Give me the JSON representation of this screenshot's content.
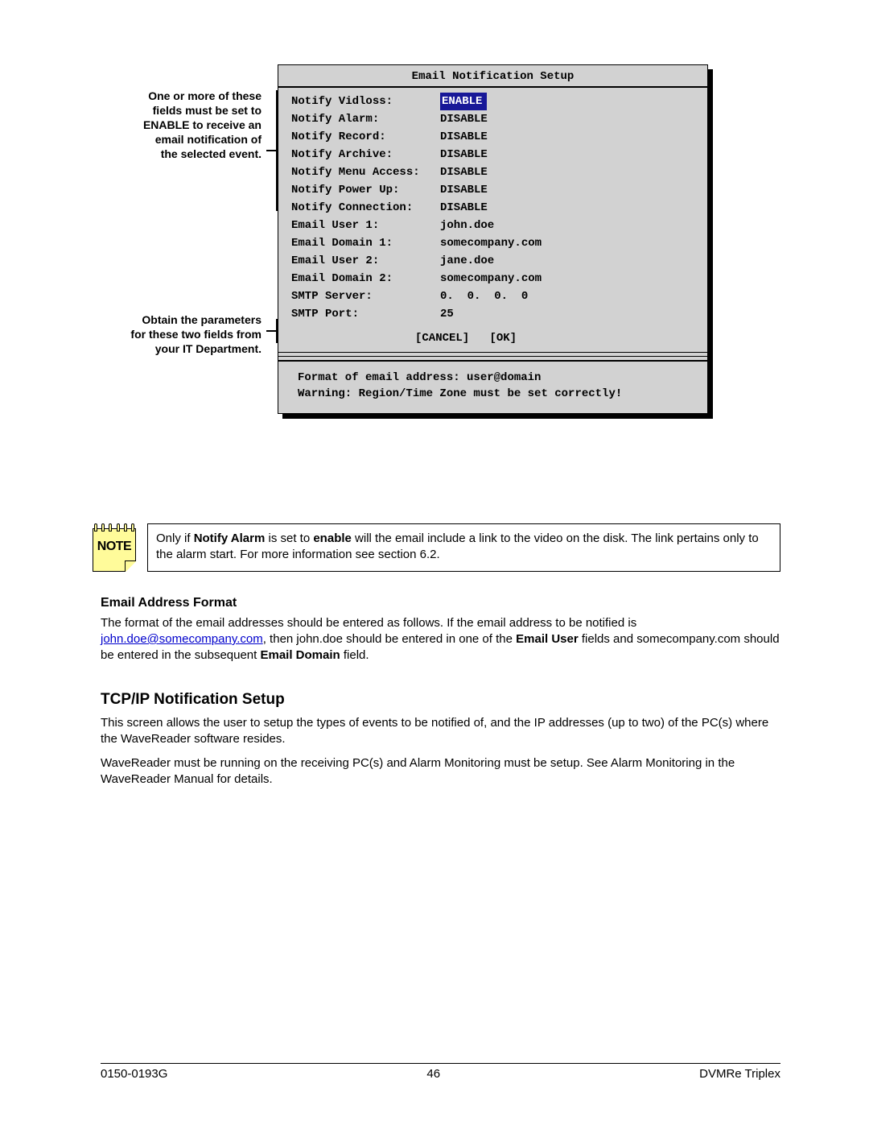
{
  "menu": {
    "title": "Email Notification Setup",
    "rows": [
      {
        "label": "Notify Vidloss:",
        "value": "ENABLE",
        "highlight": true
      },
      {
        "label": "Notify Alarm:",
        "value": "DISABLE"
      },
      {
        "label": "Notify Record:",
        "value": "DISABLE"
      },
      {
        "label": "Notify Archive:",
        "value": "DISABLE"
      },
      {
        "label": "Notify Menu Access:",
        "value": "DISABLE"
      },
      {
        "label": "Notify Power Up:",
        "value": "DISABLE"
      },
      {
        "label": "Notify Connection:",
        "value": "DISABLE"
      },
      {
        "label": "Email User 1:",
        "value": "john.doe"
      },
      {
        "label": "Email Domain 1:",
        "value": "somecompany.com"
      },
      {
        "label": "Email User 2:",
        "value": "jane.doe"
      },
      {
        "label": "Email Domain 2:",
        "value": "somecompany.com"
      },
      {
        "label": "SMTP Server:",
        "value": "0.  0.  0.  0"
      },
      {
        "label": "SMTP Port:",
        "value": "25"
      }
    ],
    "buttons": {
      "cancel": "[CANCEL]",
      "ok": "[OK]"
    },
    "footer1": "Format of email address: user@domain",
    "footer2": "Warning: Region/Time Zone must be set correctly!"
  },
  "callouts": {
    "c1_l1": "One or more of these",
    "c1_l2": "fields must be set to",
    "c1_l3": "ENABLE to receive an",
    "c1_l4": "email notification of",
    "c1_l5": "the selected event.",
    "c2_l1": "Obtain the parameters",
    "c2_l2": "for these two fields from",
    "c2_l3": "your IT Department."
  },
  "note": {
    "badge": "NOTE",
    "t1": "Only if ",
    "b1": "Notify Alarm",
    "t2": " is set to ",
    "b2": "enable",
    "t3": " will the email include a link to the video on the disk. The link pertains only to the alarm start. For more information see section 6.2."
  },
  "sec1": {
    "heading": "Email Address Format",
    "p_t1": "The format of the email addresses should be entered as follows. If the email address to be notified is ",
    "p_link": "john.doe@somecompany.com",
    "p_t2": ", then john.doe should be entered in one of the ",
    "p_b1": "Email User",
    "p_t3": " fields and somecompany.com should be entered in the subsequent ",
    "p_b2": "Email Domain",
    "p_t4": " field."
  },
  "sec2": {
    "heading": "TCP/IP Notification Setup",
    "p1": "This screen allows the user to setup the types of events to be notified of, and the IP addresses (up to two) of the PC(s) where the WaveReader software resides.",
    "p2": "WaveReader must be running on the receiving PC(s) and Alarm Monitoring must be setup. See Alarm Monitoring in the WaveReader Manual for details."
  },
  "footer": {
    "left": "0150-0193G",
    "center": "46",
    "right": "DVMRe Triplex"
  }
}
